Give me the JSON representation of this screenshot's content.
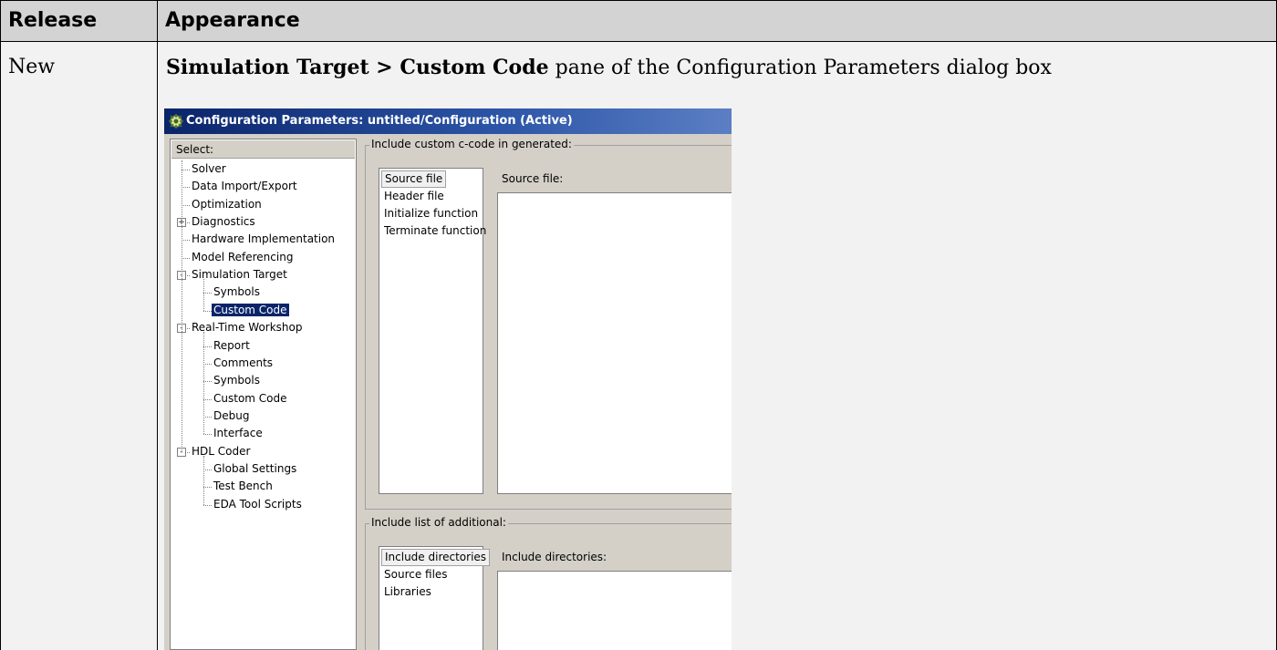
{
  "table": {
    "headers": {
      "release": "Release",
      "appearance": "Appearance"
    },
    "rows": [
      {
        "release": "New",
        "desc_bold": "Simulation Target > Custom Code",
        "desc_rest": " pane of the Configuration Parameters dialog box"
      }
    ]
  },
  "dialog": {
    "title": "Configuration Parameters: untitled/Configuration (Active)",
    "title_icon": "simulink-config-icon",
    "select_label": "Select:",
    "tree": [
      {
        "label": "Solver",
        "level": 0,
        "expander": ""
      },
      {
        "label": "Data Import/Export",
        "level": 0,
        "expander": ""
      },
      {
        "label": "Optimization",
        "level": 0,
        "expander": ""
      },
      {
        "label": "Diagnostics",
        "level": 0,
        "expander": "+"
      },
      {
        "label": "Hardware Implementation",
        "level": 0,
        "expander": ""
      },
      {
        "label": "Model Referencing",
        "level": 0,
        "expander": ""
      },
      {
        "label": "Simulation Target",
        "level": 0,
        "expander": "-"
      },
      {
        "label": "Symbols",
        "level": 1,
        "expander": ""
      },
      {
        "label": "Custom Code",
        "level": 1,
        "expander": "",
        "selected": true
      },
      {
        "label": "Real-Time Workshop",
        "level": 0,
        "expander": "-"
      },
      {
        "label": "Report",
        "level": 1,
        "expander": ""
      },
      {
        "label": "Comments",
        "level": 1,
        "expander": ""
      },
      {
        "label": "Symbols",
        "level": 1,
        "expander": ""
      },
      {
        "label": "Custom Code",
        "level": 1,
        "expander": ""
      },
      {
        "label": "Debug",
        "level": 1,
        "expander": ""
      },
      {
        "label": "Interface",
        "level": 1,
        "expander": ""
      },
      {
        "label": "HDL Coder",
        "level": 0,
        "expander": "-"
      },
      {
        "label": "Global Settings",
        "level": 1,
        "expander": ""
      },
      {
        "label": "Test Bench",
        "level": 1,
        "expander": ""
      },
      {
        "label": "EDA Tool Scripts",
        "level": 1,
        "expander": ""
      }
    ],
    "group1": {
      "title": "Include custom c-code in generated:",
      "items": [
        "Source file",
        "Header file",
        "Initialize function",
        "Terminate function"
      ],
      "selected_index": 0,
      "field_label": "Source file:",
      "field_value": ""
    },
    "group2": {
      "title": "Include list of additional:",
      "items": [
        "Include directories",
        "Source files",
        "Libraries"
      ],
      "selected_index": 0,
      "field_label": "Include directories:",
      "field_value": ""
    }
  }
}
